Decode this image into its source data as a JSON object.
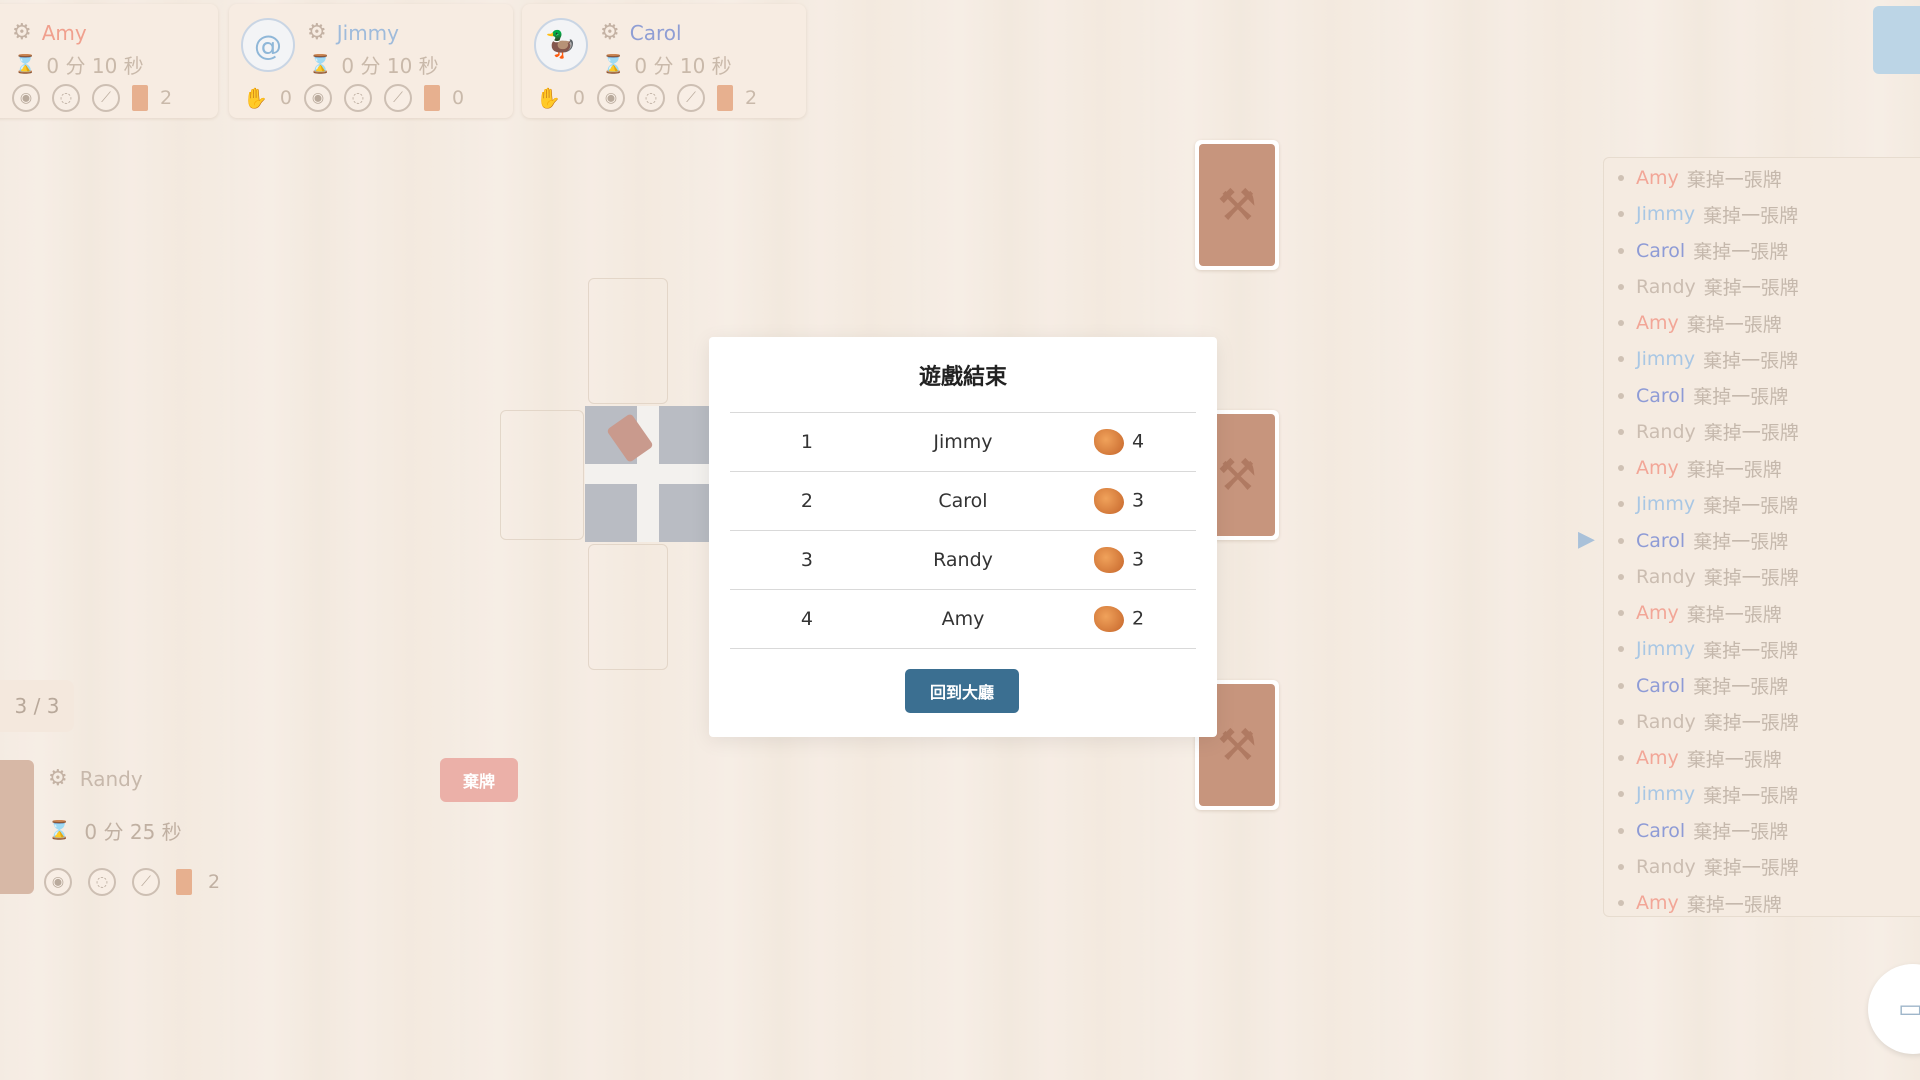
{
  "players": [
    {
      "name": "Amy",
      "name_color": "#f0a08e",
      "time": "0 分 10 秒",
      "hand": "",
      "cards": "2"
    },
    {
      "name": "Jimmy",
      "name_color": "#9fbbdb",
      "time": "0 分 10 秒",
      "hand": "0",
      "cards": "0"
    },
    {
      "name": "Carol",
      "name_color": "#8f9ed4",
      "time": "0 分 10 秒",
      "hand": "0",
      "cards": "2"
    }
  ],
  "pager": "3 / 3",
  "self": {
    "name": "Randy",
    "time": "0 分 25 秒",
    "cards": "2",
    "discard_label": "棄牌"
  },
  "log": [
    {
      "name": "Amy",
      "color": "#f2a697",
      "msg": "棄掉一張牌"
    },
    {
      "name": "Jimmy",
      "color": "#a9c7e4",
      "msg": "棄掉一張牌"
    },
    {
      "name": "Carol",
      "color": "#8e9bd6",
      "msg": "棄掉一張牌"
    },
    {
      "name": "Randy",
      "color": "#cbbdb1",
      "msg": "棄掉一張牌"
    },
    {
      "name": "Amy",
      "color": "#f2a697",
      "msg": "棄掉一張牌"
    },
    {
      "name": "Jimmy",
      "color": "#a9c7e4",
      "msg": "棄掉一張牌"
    },
    {
      "name": "Carol",
      "color": "#8e9bd6",
      "msg": "棄掉一張牌"
    },
    {
      "name": "Randy",
      "color": "#cbbdb1",
      "msg": "棄掉一張牌"
    },
    {
      "name": "Amy",
      "color": "#f2a697",
      "msg": "棄掉一張牌"
    },
    {
      "name": "Jimmy",
      "color": "#a9c7e4",
      "msg": "棄掉一張牌"
    },
    {
      "name": "Carol",
      "color": "#8e9bd6",
      "msg": "棄掉一張牌"
    },
    {
      "name": "Randy",
      "color": "#cbbdb1",
      "msg": "棄掉一張牌"
    },
    {
      "name": "Amy",
      "color": "#f2a697",
      "msg": "棄掉一張牌"
    },
    {
      "name": "Jimmy",
      "color": "#a9c7e4",
      "msg": "棄掉一張牌"
    },
    {
      "name": "Carol",
      "color": "#8e9bd6",
      "msg": "棄掉一張牌"
    },
    {
      "name": "Randy",
      "color": "#cbbdb1",
      "msg": "棄掉一張牌"
    },
    {
      "name": "Amy",
      "color": "#f2a697",
      "msg": "棄掉一張牌"
    },
    {
      "name": "Jimmy",
      "color": "#a9c7e4",
      "msg": "棄掉一張牌"
    },
    {
      "name": "Carol",
      "color": "#8e9bd6",
      "msg": "棄掉一張牌"
    },
    {
      "name": "Randy",
      "color": "#cbbdb1",
      "msg": "棄掉一張牌"
    },
    {
      "name": "Amy",
      "color": "#f2a697",
      "msg": "棄掉一張牌"
    }
  ],
  "modal": {
    "title": "遊戲結束",
    "rankings": [
      {
        "rank": "1",
        "name": "Jimmy",
        "gold": "4"
      },
      {
        "rank": "2",
        "name": "Carol",
        "gold": "3"
      },
      {
        "rank": "3",
        "name": "Randy",
        "gold": "3"
      },
      {
        "rank": "4",
        "name": "Amy",
        "gold": "2"
      }
    ],
    "back_label": "回到大廳"
  }
}
